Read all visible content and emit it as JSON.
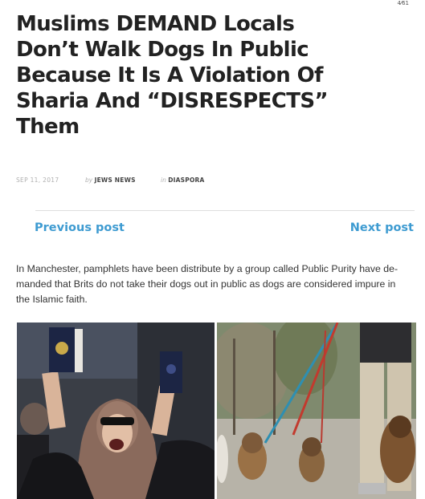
{
  "corner_mark": "4⁄61",
  "article": {
    "headline_lines": [
      "Muslims DEMAND Locals",
      "Don’t Walk Dogs In Public",
      "Because It Is A Violation Of",
      "Sharia And “DISRESPECTS”",
      "Them"
    ],
    "date": "SEP 11, 2017",
    "author_prefix": "by",
    "author": "JEWS NEWS",
    "category_prefix": "in",
    "category": "DIASPORA",
    "body_lines": [
      "In Manchester, pamphlets have been distribute by a group called Public Purity have de-",
      "manded that Brits do not take their dogs out in public as dogs are considered impure in",
      "the Islamic faith."
    ]
  },
  "navigation": {
    "previous_label": "Previous post",
    "next_label": "Next post"
  },
  "colors": {
    "link": "#3e9bd1",
    "headline": "#222222",
    "meta": "#b0b0b0"
  }
}
